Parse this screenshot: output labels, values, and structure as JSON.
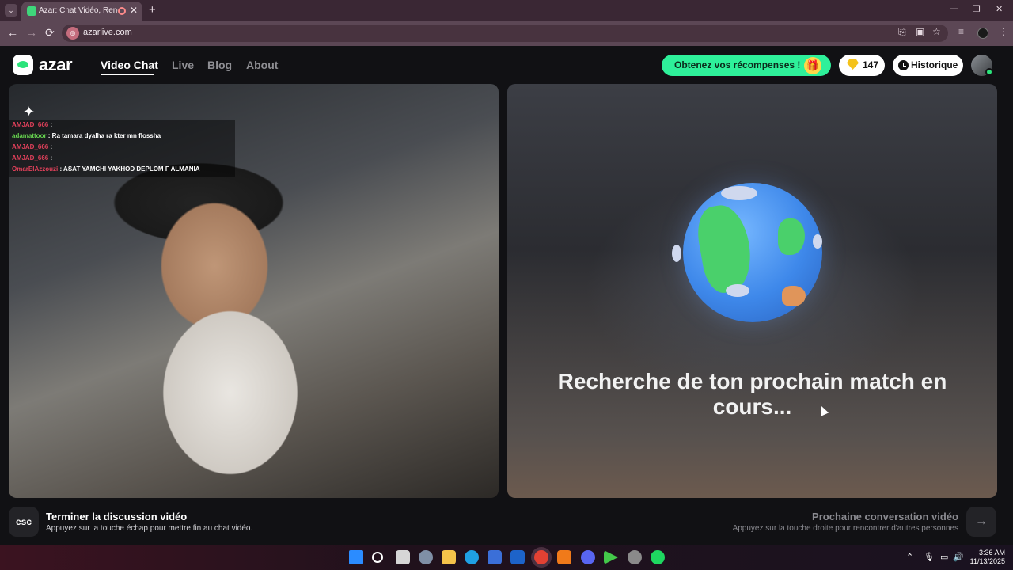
{
  "browser": {
    "tab_title": "Azar: Chat Vidéo, Rencontr",
    "url": "azarlive.com",
    "new_tab": "+",
    "back": "←",
    "forward": "→",
    "reload": "⟳",
    "tab_close": "✕",
    "minimize": "—",
    "maximize": "❐",
    "close": "✕"
  },
  "site": {
    "logo_text": "azar",
    "nav": [
      "Video Chat",
      "Live",
      "Blog",
      "About"
    ],
    "active_nav": "Video Chat",
    "rewards_label": "Obtenez vos récompenses !",
    "gems_count": "147",
    "history_label": "Historique"
  },
  "chat": [
    {
      "user": "AMJAD_666",
      "msg": ":"
    },
    {
      "user": "adamattoor",
      "msg": ": Ra tamara dyalha ra kter mn flossha"
    },
    {
      "user": "AMJAD_666",
      "msg": ":"
    },
    {
      "user": "AMJAD_666",
      "msg": ":"
    },
    {
      "user": "OmarElAzzouzi",
      "msg": ": ASAT YAMCHI YAKHOD DEPLOM F ALMANIA"
    }
  ],
  "remote": {
    "status_text": "Recherche de ton prochain match en cours..."
  },
  "footer": {
    "esc_key": "esc",
    "end_title": "Terminer la discussion vidéo",
    "end_desc": "Appuyez sur la touche échap pour mettre fin au chat vidéo.",
    "next_title": "Prochaine conversation vidéo",
    "next_desc": "Appuyez sur la touche droite pour rencontrer d'autres personnes",
    "next_arrow": "→"
  },
  "taskbar": {
    "time": "3:36 AM",
    "date": "11/13/2025"
  },
  "colors": {
    "accent_green": "#2ef09a",
    "gem_gold": "#f4c21a",
    "chat_user_red": "#e0405a",
    "chat_user_green": "#66d24f"
  }
}
